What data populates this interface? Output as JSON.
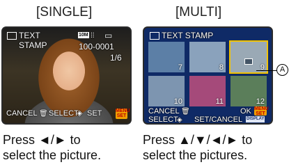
{
  "headings": {
    "single": "[SINGLE]",
    "multi": "[MULTI]"
  },
  "single_screen": {
    "text_label": "TEXT",
    "stamp_label": "STAMP",
    "size_badge": "10M",
    "file_number": "100-0001",
    "counter": "1/6",
    "cancel_label": "CANCEL",
    "select_label": "SELECT",
    "set_label": "SET",
    "menu_badge": "MENU SET"
  },
  "multi_screen": {
    "title": "TEXT STAMP",
    "thumbnails": [
      {
        "number": "7"
      },
      {
        "number": "8"
      },
      {
        "number": "9"
      },
      {
        "number": "10"
      },
      {
        "number": "11"
      },
      {
        "number": "12"
      }
    ],
    "cancel_label": "CANCEL",
    "ok_label": "OK",
    "menu_badge": "MENU SET",
    "select_label": "SELECT",
    "set_cancel_label": "SET/CANCEL",
    "display_badge": "DISPLAY",
    "callout": "A"
  },
  "captions": {
    "single_line1": "Press ◄/► to",
    "single_line2": "select the picture.",
    "multi_line1": "Press ▲/▼/◄/► to",
    "multi_line2": "select the pictures."
  }
}
